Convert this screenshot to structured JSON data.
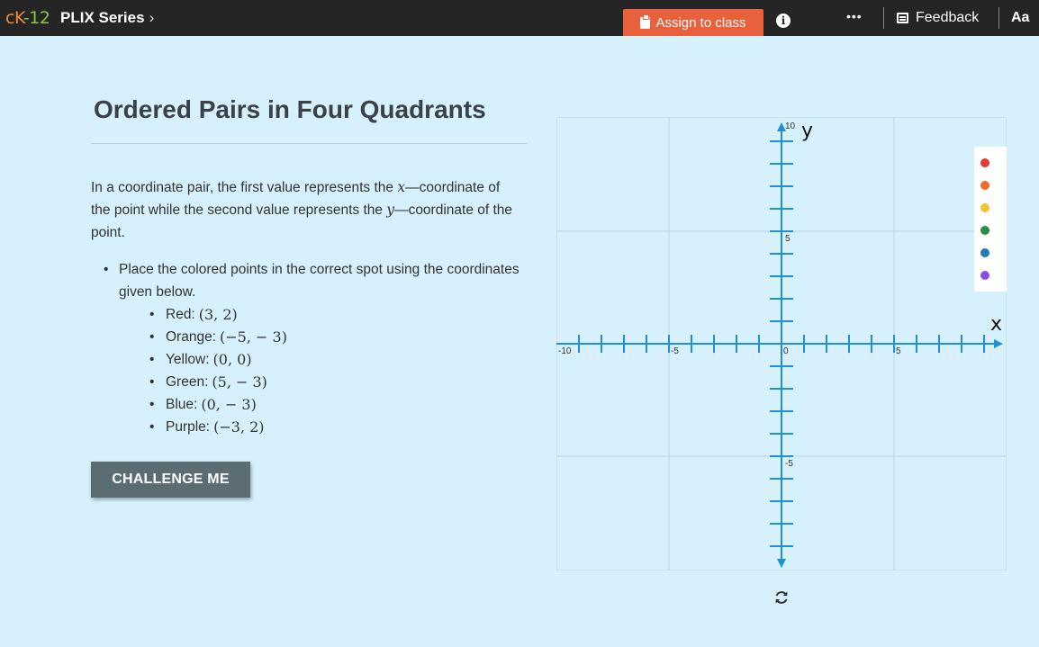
{
  "topbar": {
    "logo_ck": "cK",
    "logo_12": "-12",
    "series_label": "PLIX Series",
    "series_chevron": "›",
    "assign_label": "Assign to class",
    "info_glyph": "i",
    "more_glyph": "•••",
    "feedback_label": "Feedback",
    "text_size_label": "Aa",
    "icons": [
      "clipboard-icon",
      "info-icon",
      "more-icon",
      "feedback-icon",
      "text-size-icon"
    ]
  },
  "lesson": {
    "title": "Ordered Pairs in Four Quadrants",
    "intro_1": "In a coordinate pair, the first value represents the ",
    "intro_var_x": "x",
    "intro_2": "—coordinate of the point while the second value represents the ",
    "intro_var_y": "y",
    "intro_3": "—coordinate of the point.",
    "instruction": "Place the colored points in the correct spot using the coordinates given below.",
    "points": [
      {
        "label": "Red:",
        "coords": "(3,  2)",
        "color": "#e53935"
      },
      {
        "label": "Orange:",
        "coords": "(−5,   − 3)",
        "color": "#ef6c2c"
      },
      {
        "label": "Yellow:",
        "coords": "(0,  0)",
        "color": "#f6c12f"
      },
      {
        "label": "Green:",
        "coords": "(5,   − 3)",
        "color": "#2e8b46"
      },
      {
        "label": "Blue:",
        "coords": "(0,   − 3)",
        "color": "#1f7bc0"
      },
      {
        "label": "Purple:",
        "coords": "(−3,  2)",
        "color": "#8a4fe0"
      }
    ],
    "challenge_label": "CHALLENGE ME"
  },
  "graph": {
    "x_label": "x",
    "y_label": "y",
    "range": [
      -10,
      10
    ],
    "tick_step": 1,
    "grid_step": 5,
    "x_tick_labels": [
      {
        "value": -10,
        "text": "-10"
      },
      {
        "value": -5,
        "text": "-5"
      },
      {
        "value": 0,
        "text": "0"
      },
      {
        "value": 5,
        "text": "5"
      }
    ],
    "y_tick_labels": [
      {
        "value": 10,
        "text": "10"
      },
      {
        "value": 5,
        "text": "5"
      },
      {
        "value": -5,
        "text": "-5"
      }
    ],
    "axis_color": "#1f8fd6",
    "grid_color": "#bcd5dd",
    "refresh_icon": "refresh-icon"
  }
}
